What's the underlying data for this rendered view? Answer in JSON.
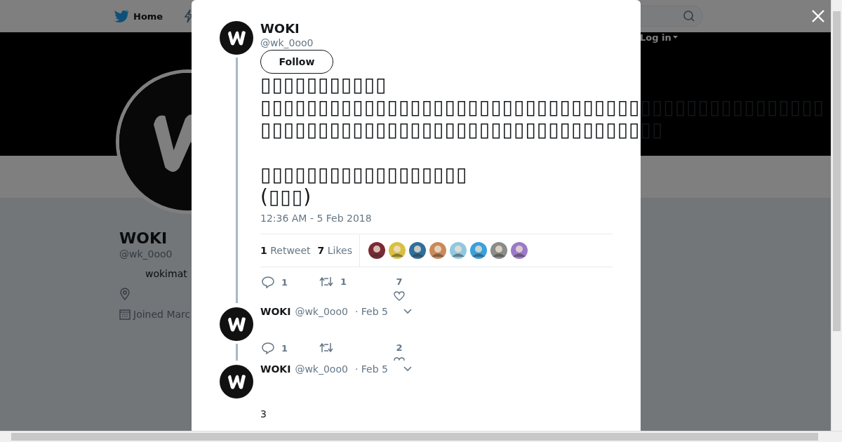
{
  "nav": {
    "home": "Home",
    "login": "Log in"
  },
  "profile": {
    "name": "WOKI",
    "handle": "@wk_0oo0",
    "bio": "wokimat",
    "joined": "Joined Marc"
  },
  "tweet": {
    "name": "WOKI",
    "handle": "@wk_0oo0",
    "follow": "Follow",
    "paragraphs": [
      [
        "▯▯▯▯▯▯▯▯▯▯▯",
        "▯▯▯▯▯▯▯▯▯▯▯▯▯▯▯▯▯▯▯▯▯▯▯▯▯▯▯▯▯▯▯▯▯▯▯▯▯▯▯▯▯▯▯▯▯▯▯▯▯",
        "▯▯▯▯▯▯▯▯▯▯▯▯▯▯▯▯▯▯▯▯▯▯▯▯▯▯▯▯▯▯▯▯▯▯▯"
      ],
      [
        "▯▯▯▯▯▯▯▯▯▯▯▯▯▯▯▯▯▯",
        "(▯▯▯)"
      ]
    ],
    "time": "12:36 AM - 5 Feb 2018",
    "retweet_count": "1",
    "retweet_label": "Retweet",
    "like_count": "7",
    "like_label": "Likes",
    "likers": [
      {
        "color": "#7a2a35"
      },
      {
        "color": "#d8c040"
      },
      {
        "color": "#2f6f9a"
      },
      {
        "color": "#c88a5a"
      },
      {
        "color": "#8fc8e0"
      },
      {
        "color": "#3aa0dc"
      },
      {
        "color": "#8a8c88"
      },
      {
        "color": "#9a7ac8"
      }
    ],
    "actions": {
      "replies": "1",
      "retweets": "1",
      "likes": "7"
    }
  },
  "replies": [
    {
      "name": "WOKI",
      "handle": "@wk_0oo0",
      "date": "· Feb 5",
      "actions": {
        "replies": "1",
        "likes": "2"
      }
    },
    {
      "name": "WOKI",
      "handle": "@wk_0oo0",
      "date": "· Feb 5",
      "text": "3"
    }
  ]
}
